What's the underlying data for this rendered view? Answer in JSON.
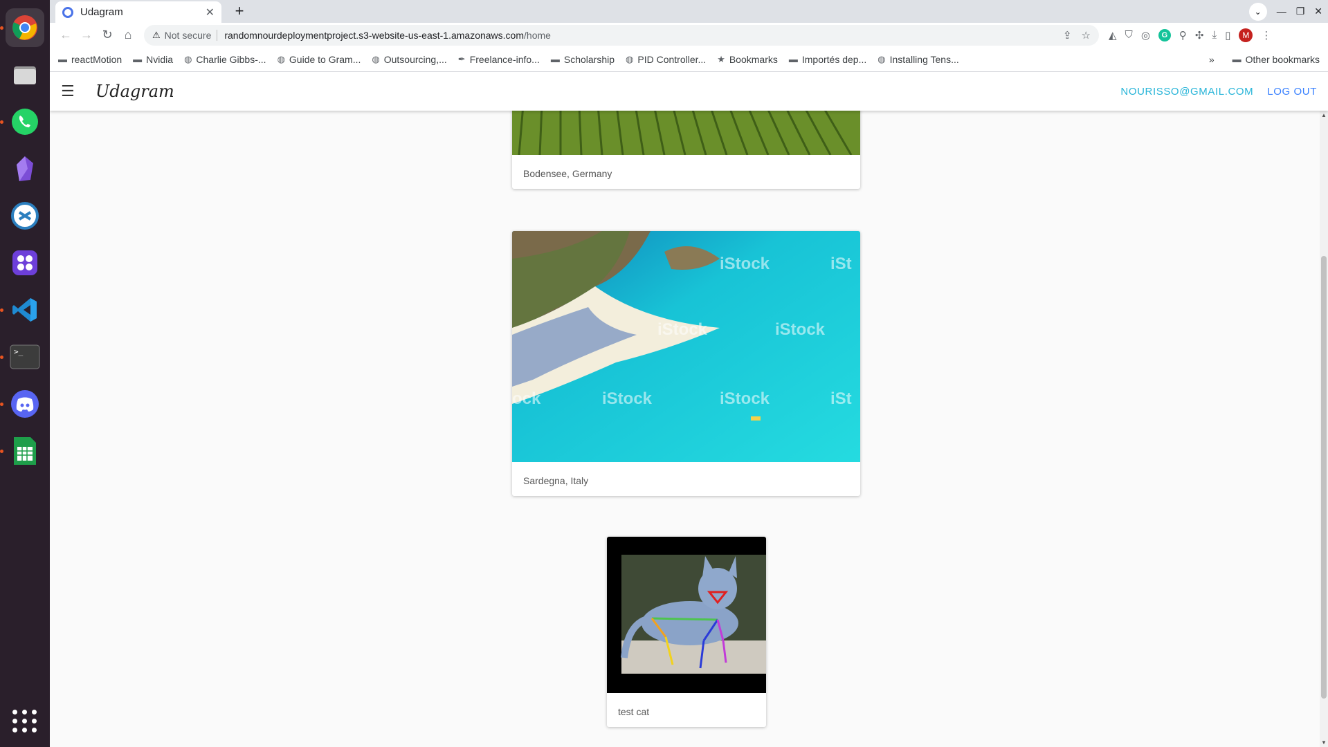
{
  "dock": {
    "items": [
      {
        "name": "chrome-icon",
        "active": true
      },
      {
        "name": "files-icon"
      },
      {
        "name": "whatsapp-icon"
      },
      {
        "name": "obsidian-icon"
      },
      {
        "name": "remote-desktop-icon"
      },
      {
        "name": "slack-icon"
      },
      {
        "name": "vscode-icon"
      },
      {
        "name": "terminal-icon"
      },
      {
        "name": "discord-icon"
      },
      {
        "name": "spreadsheet-icon"
      }
    ]
  },
  "browser": {
    "tab_title": "Udagram",
    "address": {
      "security_label": "Not secure",
      "host": "randomnourdeploymentproject.s3-website-us-east-1.amazonaws.com",
      "path": "/home"
    },
    "profile_initial": "M",
    "bookmarks": [
      {
        "label": "reactMotion",
        "icon": "folder-icon"
      },
      {
        "label": "Nvidia",
        "icon": "folder-icon"
      },
      {
        "label": "Charlie Gibbs-...",
        "icon": "globe-icon"
      },
      {
        "label": "Guide to Gram...",
        "icon": "globe-icon"
      },
      {
        "label": "Outsourcing,...",
        "icon": "globe-icon"
      },
      {
        "label": "Freelance-info...",
        "icon": "feather-icon"
      },
      {
        "label": "Scholarship",
        "icon": "folder-icon"
      },
      {
        "label": "PID Controller...",
        "icon": "globe-icon"
      },
      {
        "label": "Bookmarks",
        "icon": "star-icon"
      },
      {
        "label": "Importés dep...",
        "icon": "folder-icon"
      },
      {
        "label": "Installing Tens...",
        "icon": "globe-icon"
      }
    ],
    "other_bookmarks": "Other bookmarks"
  },
  "app": {
    "brand": "Udagram",
    "user_email": "NOURISSO@GMAIL.COM",
    "logout_label": "LOG OUT"
  },
  "feed": [
    {
      "caption": "Bodensee, Germany",
      "image": "vineyard-photo"
    },
    {
      "caption": "Sardegna, Italy",
      "image": "beach-aerial-photo"
    },
    {
      "caption": "test cat",
      "image": "cat-pose-photo"
    }
  ]
}
